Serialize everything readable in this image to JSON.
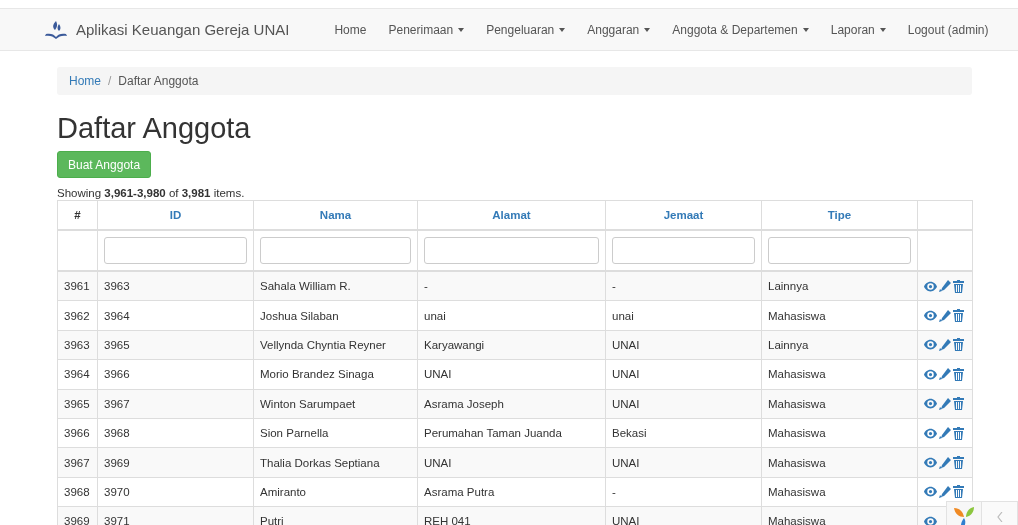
{
  "navbar": {
    "brand": "Aplikasi Keuangan Gereja UNAI",
    "items": [
      {
        "label": "Home",
        "dropdown": false
      },
      {
        "label": "Penerimaan",
        "dropdown": true
      },
      {
        "label": "Pengeluaran",
        "dropdown": true
      },
      {
        "label": "Anggaran",
        "dropdown": true
      },
      {
        "label": "Anggota & Departemen",
        "dropdown": true
      },
      {
        "label": "Laporan",
        "dropdown": true
      },
      {
        "label": "Logout (admin)",
        "dropdown": false
      }
    ]
  },
  "breadcrumb": [
    {
      "label": "Home",
      "link": true
    },
    {
      "label": "Daftar Anggota",
      "link": false
    }
  ],
  "breadcrumb_separator": "/",
  "title": "Daftar Anggota",
  "create_button": "Buat Anggota",
  "summary": "Showing **3,961-3,980** of **3,981** items.",
  "table": {
    "columns": [
      {
        "label": "#",
        "sortable": false,
        "filter": false
      },
      {
        "label": "ID",
        "sortable": true,
        "filter": true
      },
      {
        "label": "Nama",
        "sortable": true,
        "filter": true
      },
      {
        "label": "Alamat",
        "sortable": true,
        "filter": true
      },
      {
        "label": "Jemaat",
        "sortable": true,
        "filter": true
      },
      {
        "label": "Tipe",
        "sortable": true,
        "filter": true
      }
    ],
    "rows": [
      [
        "3961",
        "3963",
        "Sahala William R.",
        "-",
        "-",
        "Lainnya"
      ],
      [
        "3962",
        "3964",
        "Joshua Silaban",
        "unai",
        "unai",
        "Mahasiswa"
      ],
      [
        "3963",
        "3965",
        "Vellynda Chyntia Reyner",
        "Karyawangi",
        "UNAI",
        "Lainnya"
      ],
      [
        "3964",
        "3966",
        "Morio Brandez Sinaga",
        "UNAI",
        "UNAI",
        "Mahasiswa"
      ],
      [
        "3965",
        "3967",
        "Winton Sarumpaet",
        "Asrama Joseph",
        "UNAI",
        "Mahasiswa"
      ],
      [
        "3966",
        "3968",
        "Sion Parnella",
        "Perumahan Taman Juanda",
        "Bekasi",
        "Mahasiswa"
      ],
      [
        "3967",
        "3969",
        "Thalia Dorkas Septiana",
        "UNAI",
        "UNAI",
        "Mahasiswa"
      ],
      [
        "3968",
        "3970",
        "Amiranto",
        "Asrama Putra",
        "-",
        "Mahasiswa"
      ],
      [
        "3969",
        "3971",
        "Putri",
        "REH 041",
        "UNAI",
        "Mahasiswa"
      ]
    ]
  }
}
